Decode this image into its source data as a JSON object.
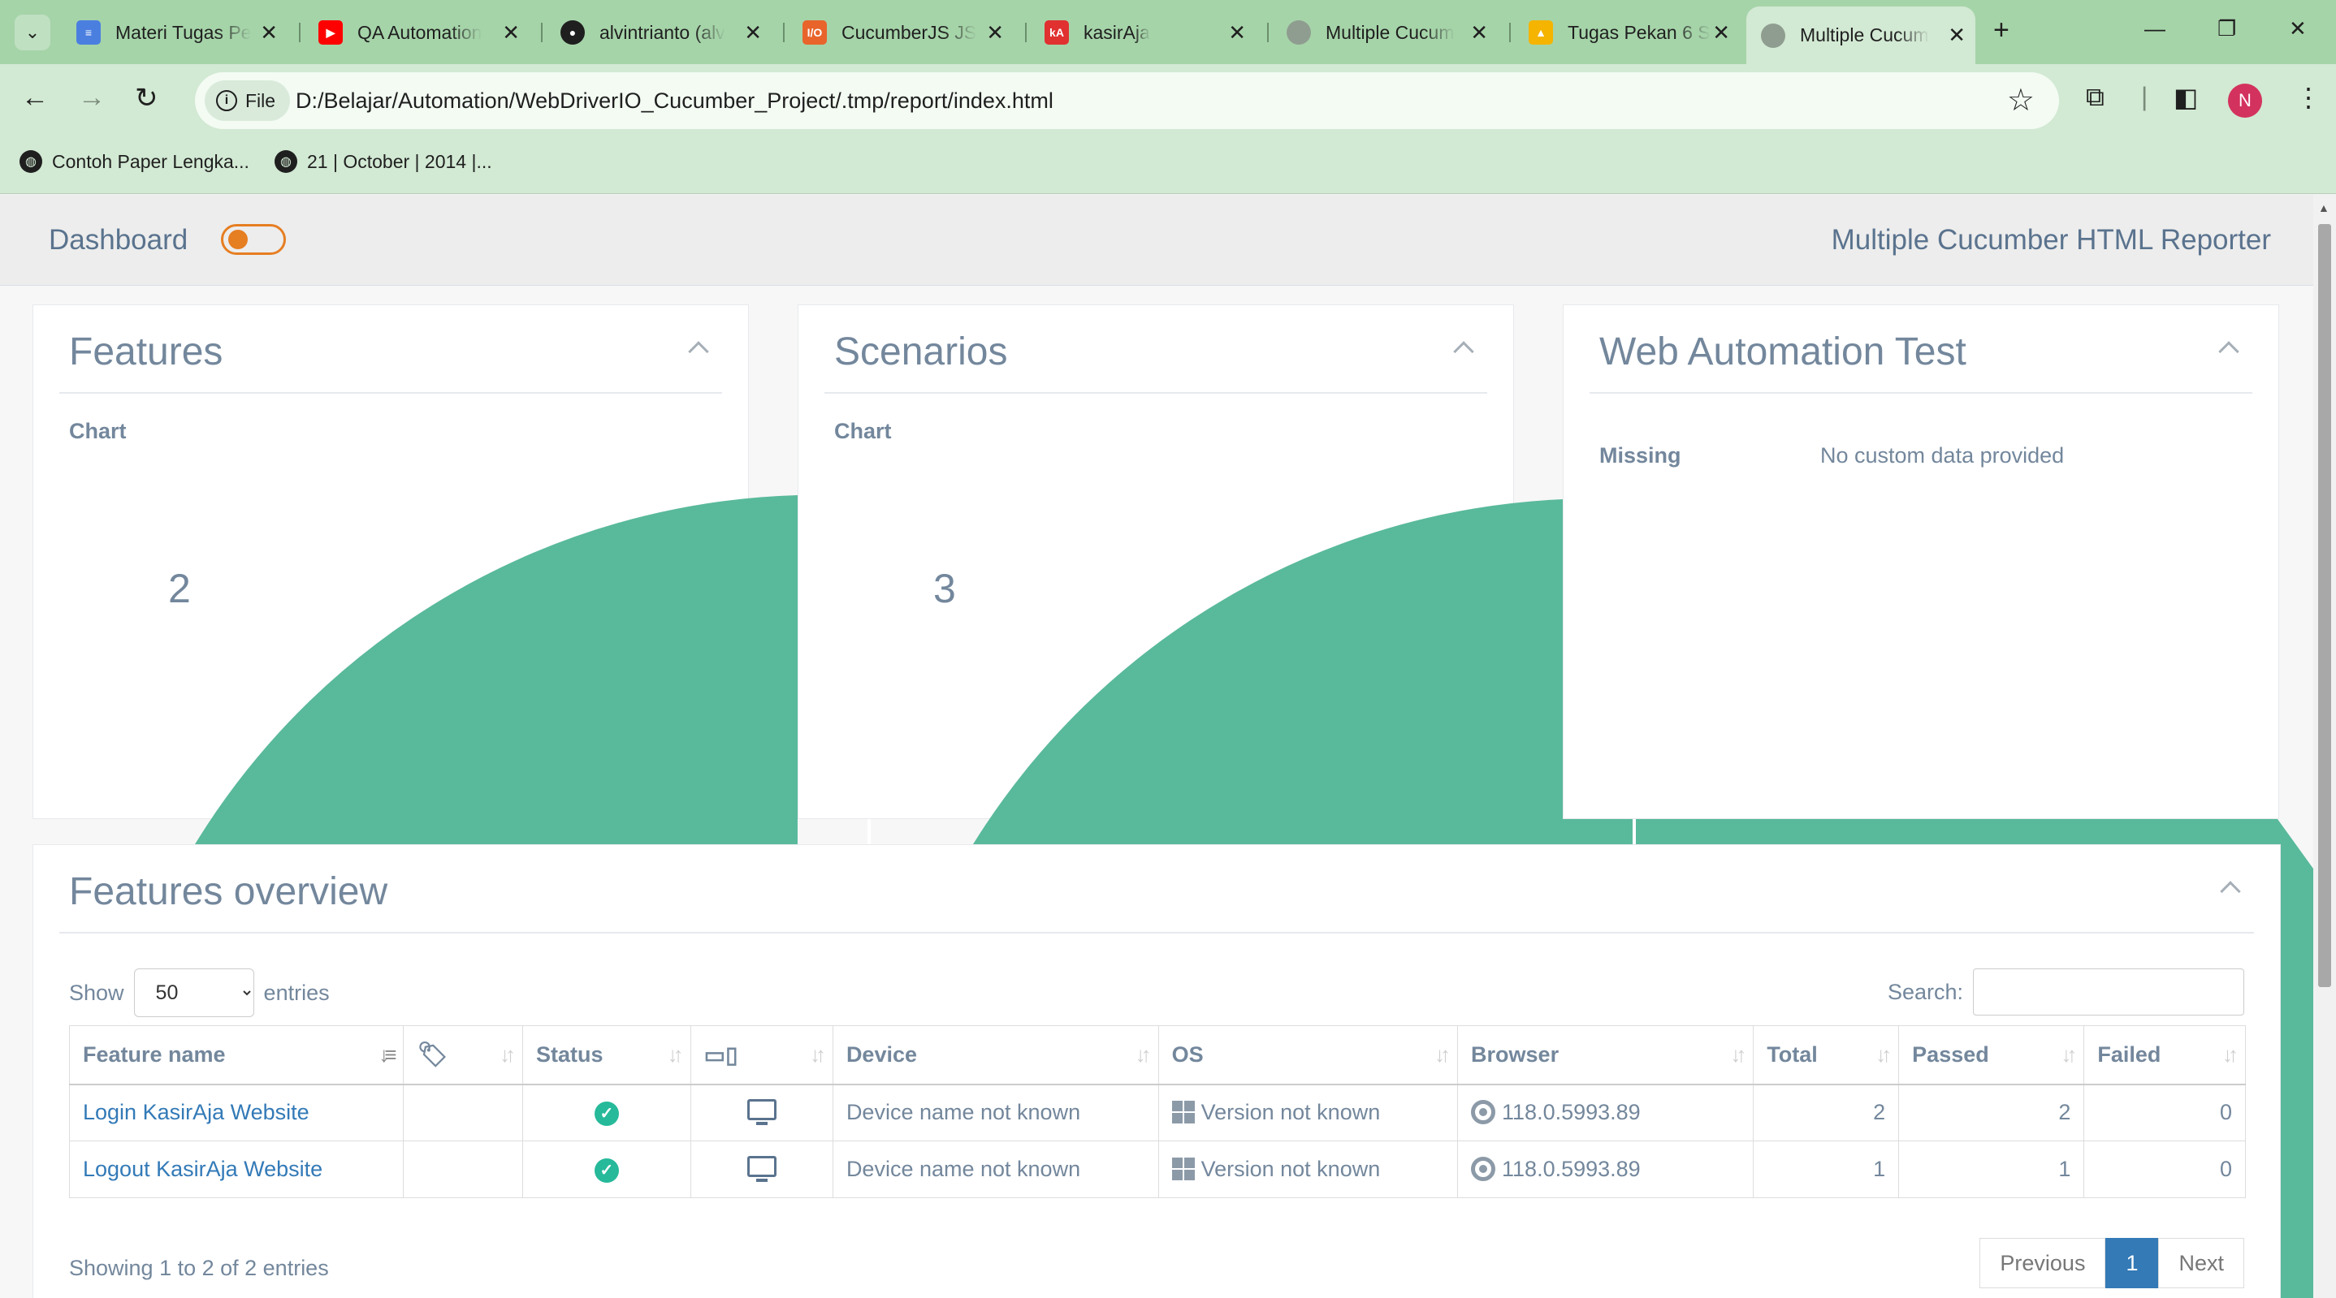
{
  "browser": {
    "tabs": [
      {
        "title": "Materi Tugas Pe",
        "favicon": "doc-icon",
        "color": "#4a7fe0"
      },
      {
        "title": "QA Automation",
        "favicon": "youtube-icon",
        "color": "#ff0000"
      },
      {
        "title": "alvintrianto (alv",
        "favicon": "github-icon",
        "color": "#1f1f1f"
      },
      {
        "title": "CucumberJS JS",
        "favicon": "io-icon",
        "color": "#e8642b"
      },
      {
        "title": "kasirAja",
        "favicon": "kasiraja-icon",
        "color": "#e03030"
      },
      {
        "title": "Multiple Cucum",
        "favicon": "globe-icon",
        "color": "#8f9d90"
      },
      {
        "title": "Tugas Pekan 6 S",
        "favicon": "drive-icon",
        "color": "#f4b400"
      },
      {
        "title": "Multiple Cucum",
        "favicon": "globe-icon",
        "color": "#8f9d90"
      }
    ],
    "address": {
      "chip": "File",
      "url": "D:/Belajar/Automation/WebDriverIO_Cucumber_Project/.tmp/report/index.html"
    },
    "profile_initial": "N",
    "bookmarks": [
      "Contoh Paper Lengka...",
      "21 | October | 2014 |..."
    ]
  },
  "nav": {
    "title": "Dashboard",
    "reporter": "Multiple Cucumber HTML Reporter"
  },
  "panels": {
    "features": {
      "title": "Features",
      "chart_label": "Chart",
      "count": "2"
    },
    "scenarios": {
      "title": "Scenarios",
      "chart_label": "Chart",
      "count": "3"
    },
    "metadata": {
      "title": "Web Automation Test",
      "key": "Missing",
      "value": "No custom data provided"
    }
  },
  "overview": {
    "title": "Features overview",
    "show_label": "Show",
    "entries_label": "entries",
    "page_size": "50",
    "search_label": "Search:",
    "columns": [
      "Feature name",
      "",
      "Status",
      "",
      "Device",
      "OS",
      "Browser",
      "Total",
      "Passed",
      "Failed"
    ],
    "rows": [
      {
        "name": "Login KasirAja Website",
        "device": "Device name not known",
        "os": "Version not known",
        "browser": "118.0.5993.89",
        "total": "2",
        "passed": "2",
        "failed": "0"
      },
      {
        "name": "Logout KasirAja Website",
        "device": "Device name not known",
        "os": "Version not known",
        "browser": "118.0.5993.89",
        "total": "1",
        "passed": "1",
        "failed": "0"
      }
    ],
    "info": "Showing 1 to 2 of 2 entries",
    "pager": {
      "prev": "Previous",
      "page": "1",
      "next": "Next"
    }
  },
  "colors": {
    "accent": "#26b99a",
    "chart_fill": "#59b99b",
    "link": "#337ab7",
    "browser_frame": "#a6d4a9"
  }
}
